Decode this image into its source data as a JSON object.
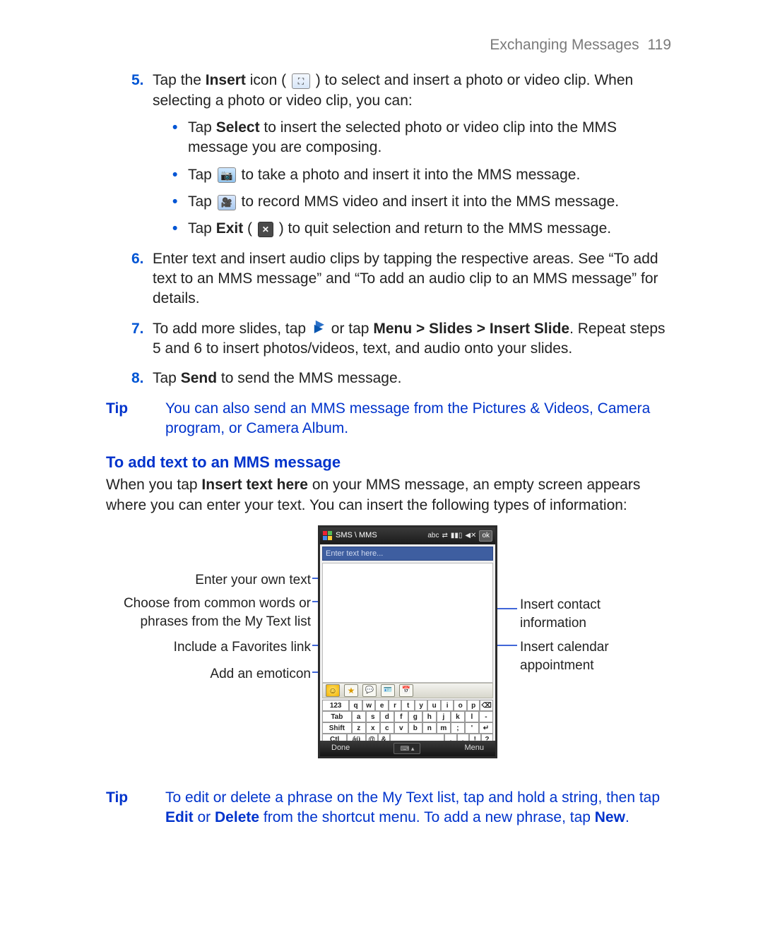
{
  "header": {
    "title": "Exchanging Messages",
    "page_number": "119"
  },
  "steps": {
    "s5": {
      "num": "5.",
      "pre": "Tap the ",
      "bold1": "Insert",
      "mid": " icon ( ",
      "post": " ) to select and insert a photo or video clip. When selecting a photo or video clip, you can:"
    },
    "s5b1": {
      "pre": "Tap ",
      "bold": "Select",
      "post": " to insert the selected photo or video clip into the MMS message you are composing."
    },
    "s5b2": {
      "pre": "Tap ",
      "post": " to take a photo and insert it into the MMS message."
    },
    "s5b3": {
      "pre": "Tap ",
      "post": " to record MMS video and insert it into the MMS message."
    },
    "s5b4": {
      "pre": "Tap ",
      "bold": "Exit",
      "mid": " ( ",
      "post": " ) to quit selection and return to the MMS message."
    },
    "s6": {
      "num": "6.",
      "text": "Enter text and insert audio clips by tapping the respective areas. See “To add text to an MMS message” and “To add an audio clip to an MMS message” for details."
    },
    "s7": {
      "num": "7.",
      "pre": "To add more slides, tap ",
      "mid": " or tap ",
      "bold": "Menu > Slides > Insert Slide",
      "post": ". Repeat steps 5 and 6 to insert photos/videos, text, and audio onto your slides."
    },
    "s8": {
      "num": "8.",
      "pre": "Tap ",
      "bold": "Send",
      "post": " to send the MMS message."
    }
  },
  "tip1": {
    "label": "Tip",
    "text": "You can also send an MMS message from the Pictures & Videos, Camera program, or Camera Album."
  },
  "section_title": "To add text to an MMS message",
  "section_body": {
    "pre": "When you tap ",
    "bold": "Insert text here",
    "post": " on your MMS message, an empty screen appears where you can enter your text. You can insert the following types of information:"
  },
  "phone": {
    "title_app": "SMS \\ MMS",
    "title_status": "abc",
    "title_ok": "ok",
    "input_placeholder": "Enter text here...",
    "softkeys": {
      "left": "Done",
      "right": "Menu"
    },
    "keyboard": {
      "r1": [
        "123",
        "q",
        "w",
        "e",
        "r",
        "t",
        "y",
        "u",
        "i",
        "o",
        "p",
        "⌫"
      ],
      "r2": [
        "Tab",
        "a",
        "s",
        "d",
        "f",
        "g",
        "h",
        "j",
        "k",
        "l",
        "-"
      ],
      "r3": [
        "Shift",
        "z",
        "x",
        "c",
        "v",
        "b",
        "n",
        "m",
        ";",
        "'",
        "↵"
      ],
      "r4": [
        "Ctl",
        "áü",
        "@",
        "&",
        "",
        ",",
        ".",
        "!",
        "?"
      ]
    }
  },
  "callouts": {
    "l1": "Enter your own text",
    "l2": "Choose from common words or phrases from the My Text list",
    "l3": "Include a Favorites link",
    "l4": "Add an emoticon",
    "r1": "Insert contact information",
    "r2": "Insert calendar appointment"
  },
  "tip2": {
    "label": "Tip",
    "pre": "To edit or delete a phrase on the My Text list, tap and hold a string, then tap ",
    "b1": "Edit",
    "mid1": " or ",
    "b2": "Delete",
    "mid2": " from the shortcut menu. To add a new phrase, tap ",
    "b3": "New",
    "post": "."
  }
}
